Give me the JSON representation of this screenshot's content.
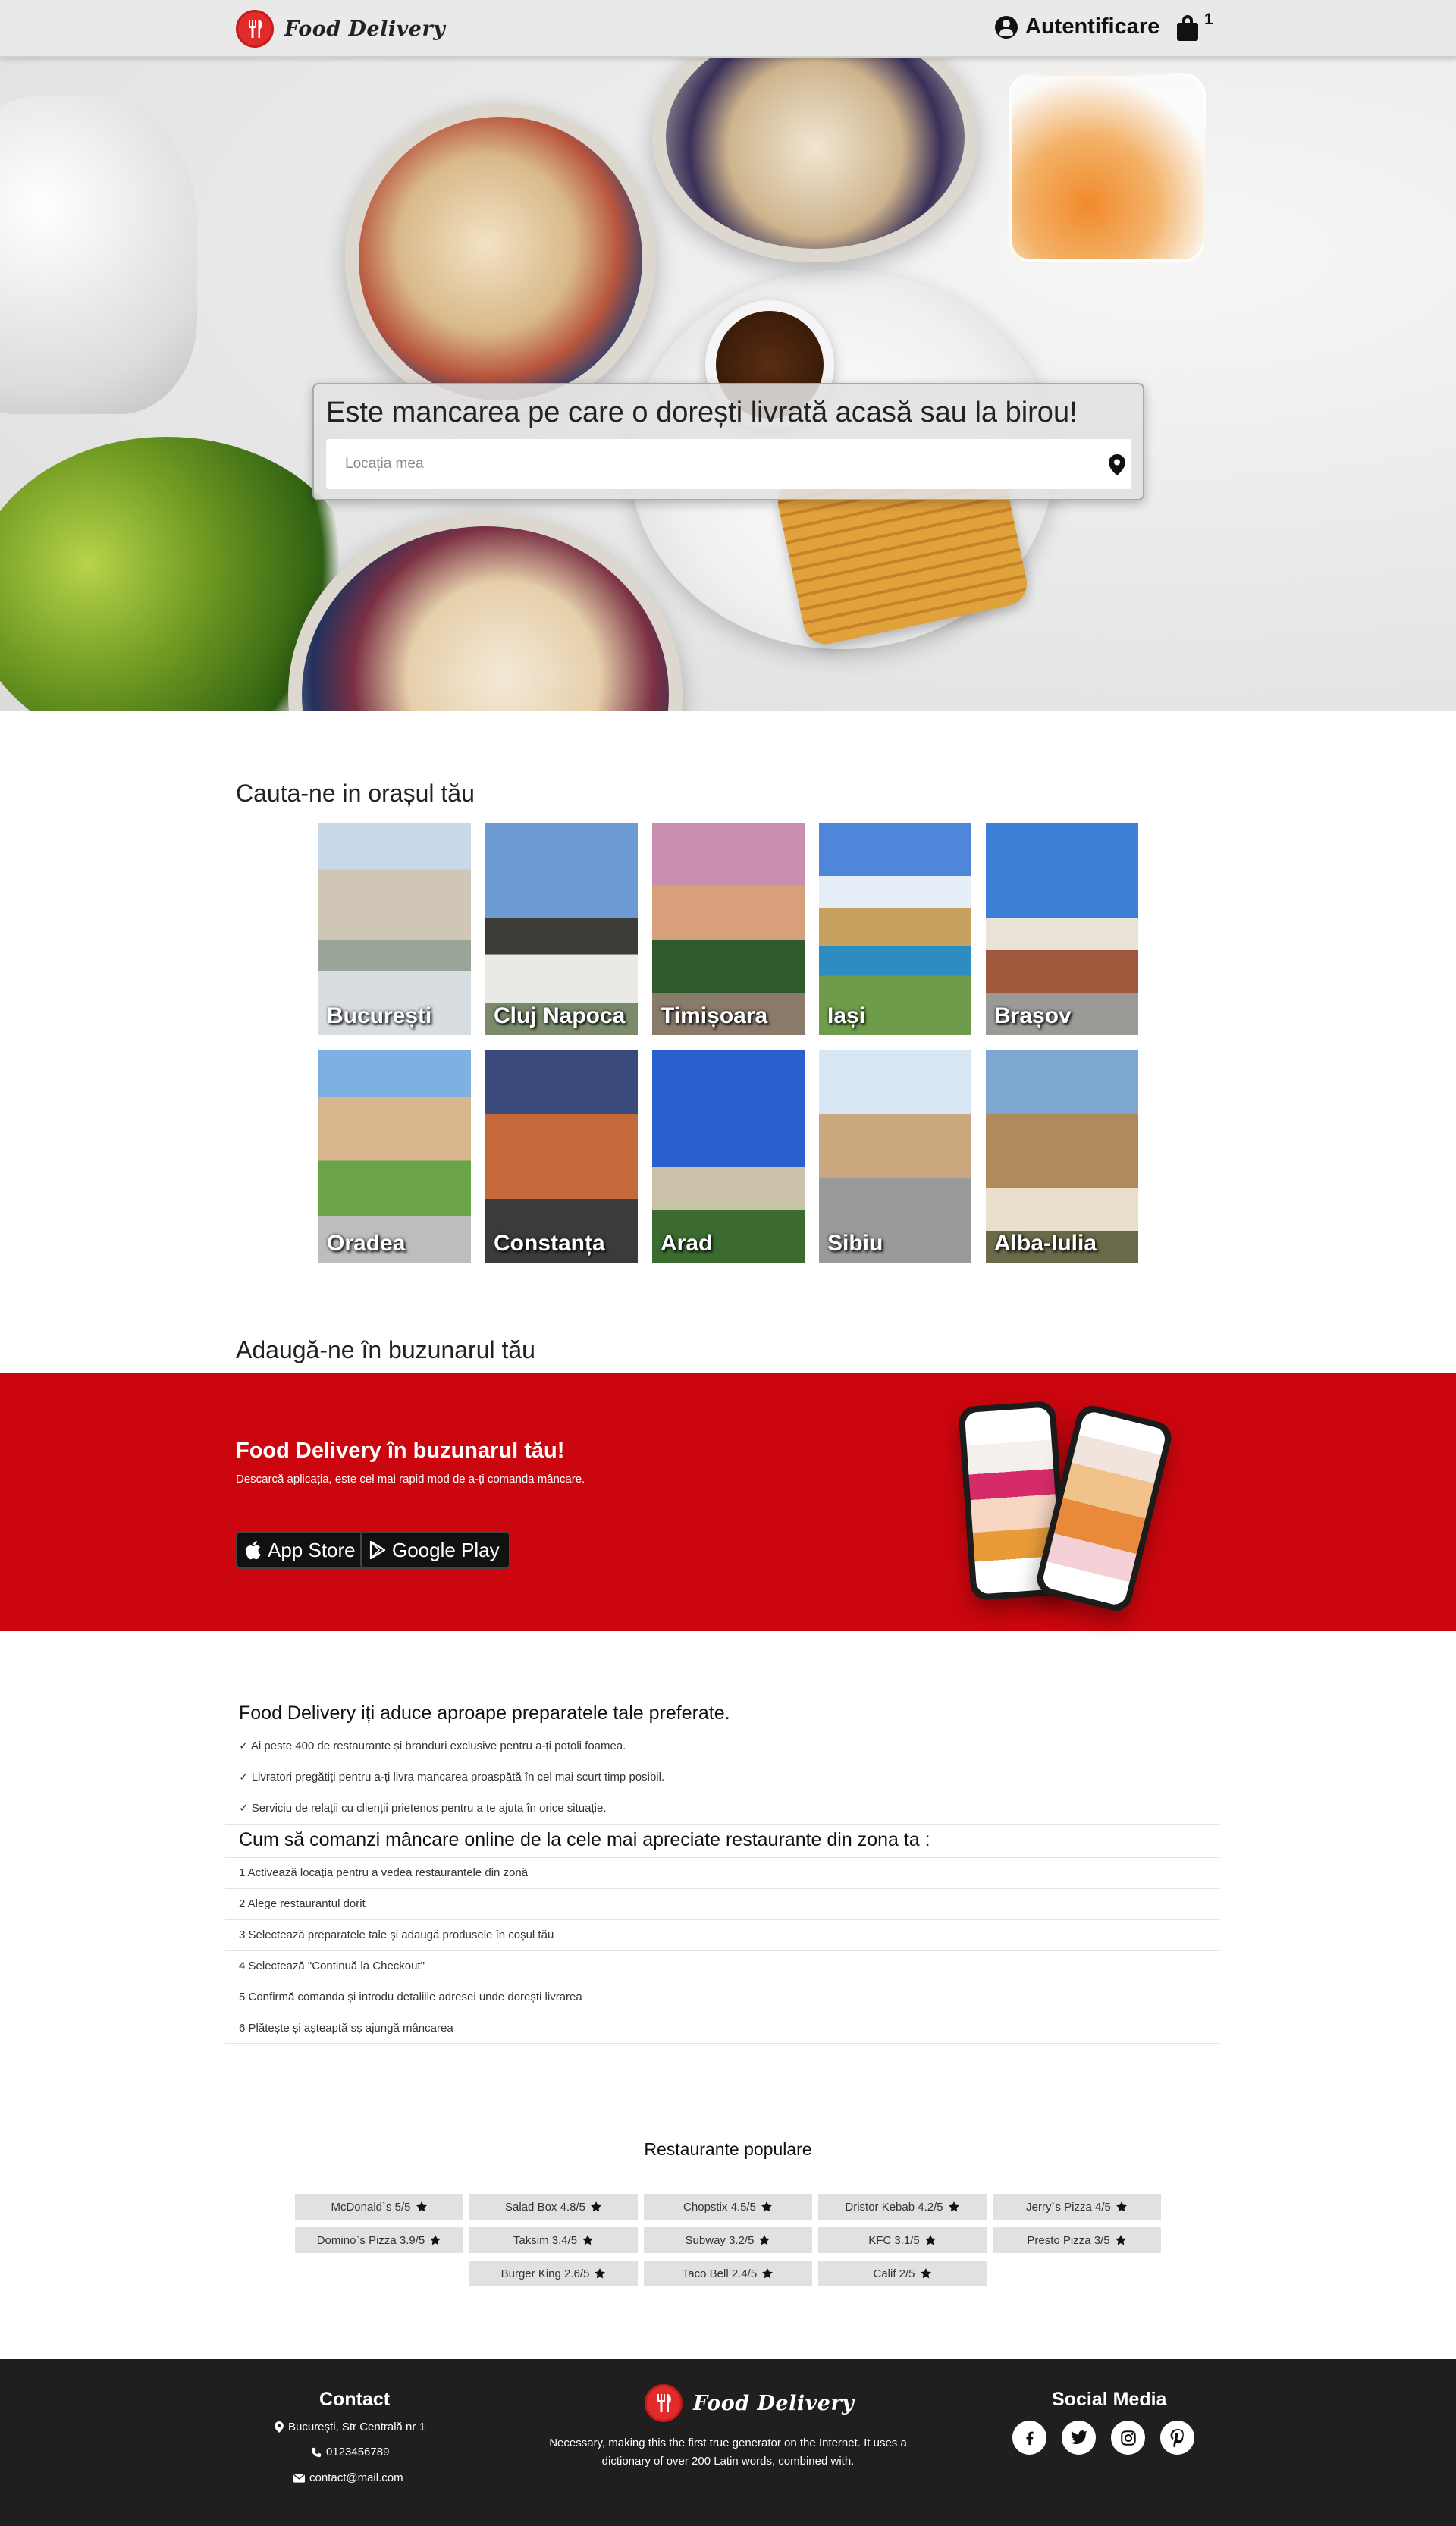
{
  "header": {
    "brand": "Food Delivery",
    "auth_label": "Autentificare",
    "cart_count": "1"
  },
  "hero": {
    "title": "Este mancarea pe care o dorești livrată acasă sau la birou!",
    "search_placeholder": "Locația mea"
  },
  "cities": {
    "title": "Cauta-ne in orașul tău",
    "items": [
      {
        "name": "București"
      },
      {
        "name": "Cluj Napoca"
      },
      {
        "name": "Timișoara"
      },
      {
        "name": "Iași"
      },
      {
        "name": "Brașov"
      },
      {
        "name": "Oradea"
      },
      {
        "name": "Constanța"
      },
      {
        "name": "Arad"
      },
      {
        "name": "Sibiu"
      },
      {
        "name": "Alba-Iulia"
      }
    ]
  },
  "app": {
    "section_title": "Adaugă-ne în buzunarul tău",
    "title": "Food Delivery în buzunarul tău!",
    "subtitle": "Descarcă aplicația, este cel mai rapid mod de a-ți comanda mâncare.",
    "app_store_label": "App Store",
    "google_play_label": "Google Play"
  },
  "benefits": {
    "title": "Food Delivery iți aduce aproape preparatele tale preferate.",
    "items": [
      "✓ Ai peste 400 de restaurante și branduri exclusive pentru a-ți potoli foamea.",
      "✓ Livratori pregătiți pentru a-ți livra mancarea proaspătă în cel mai scurt timp posibil.",
      "✓ Serviciu de relații cu clienții prietenos pentru a te ajuta în orice situație."
    ]
  },
  "steps": {
    "title": "Cum să comanzi mâncare online de la cele mai apreciate restaurante din zona ta :",
    "items": [
      "1 Activează locația pentru a vedea restaurantele din zonă",
      "2 Alege restaurantul dorit",
      "3 Selectează preparatele tale și adaugă produsele în coșul tău",
      "4 Selectează \"Continuă la Checkout\"",
      "5 Confirmă comanda și introdu detaliile adresei unde dorești livrarea",
      "6 Plătește și așteaptă sș ajungă mâncarea"
    ]
  },
  "popular": {
    "title": "Restaurante populare",
    "items": [
      "McDonald`s 5/5",
      "Salad Box 4.8/5",
      "Chopstix 4.5/5",
      "Dristor Kebab 4.2/5",
      "Jerry`s Pizza 4/5",
      "Domino`s Pizza 3.9/5",
      "Taksim 3.4/5",
      "Subway 3.2/5",
      "KFC 3.1/5",
      "Presto Pizza 3/5",
      "Burger King 2.6/5",
      "Taco Bell 2.4/5",
      "Calif 2/5"
    ]
  },
  "footer": {
    "contact_title": "Contact",
    "address": "București, Str Centrală nr 1",
    "phone": "0123456789",
    "email": "contact@mail.com",
    "brand": "Food Delivery",
    "description": "Necessary, making this the first true generator on the Internet. It uses a dictionary of over 200 Latin words, combined with.",
    "social_title": "Social Media",
    "social_icons": [
      "facebook-icon",
      "twitter-icon",
      "instagram-icon",
      "pinterest-icon"
    ]
  },
  "colors": {
    "brand_red": "#cc060e",
    "logo_red": "#e22b2b",
    "header_bg": "#e9e9e9",
    "footer_bg": "#1f1f1f"
  }
}
